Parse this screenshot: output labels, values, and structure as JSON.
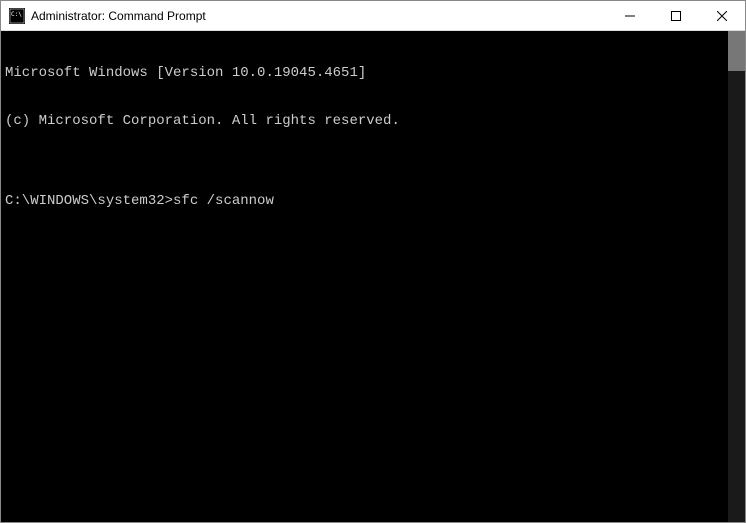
{
  "window": {
    "title": "Administrator: Command Prompt"
  },
  "terminal": {
    "line1": "Microsoft Windows [Version 10.0.19045.4651]",
    "line2": "(c) Microsoft Corporation. All rights reserved.",
    "blank1": "",
    "prompt": "C:\\WINDOWS\\system32>",
    "command": "sfc /scannow"
  }
}
